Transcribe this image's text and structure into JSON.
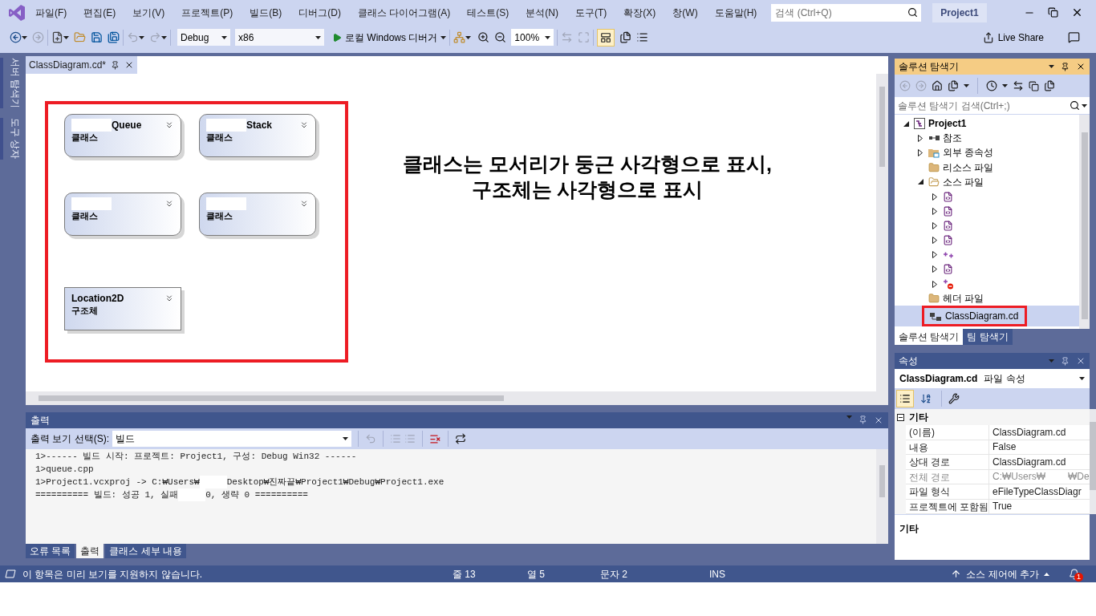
{
  "title_bar": {
    "menus": [
      "파일(F)",
      "편집(E)",
      "보기(V)",
      "프로젝트(P)",
      "빌드(B)",
      "디버그(D)",
      "클래스 다이어그램(A)",
      "테스트(S)",
      "분석(N)",
      "도구(T)",
      "확장(X)",
      "창(W)",
      "도움말(H)"
    ],
    "search": {
      "placeholder": "검색 (Ctrl+Q)"
    },
    "project_name": "Project1"
  },
  "toolbar": {
    "configuration": "Debug",
    "platform": "x86",
    "run_label": "로컬 Windows 디버거",
    "zoom": "100%",
    "display_toggle": {
      "on": true
    },
    "live_share": "Live Share"
  },
  "side_tabs": [
    "서버 탐색기",
    "도구 상자"
  ],
  "editor": {
    "tab": {
      "label": "ClassDiagram.cd*",
      "selected": true
    },
    "shapes": [
      {
        "kind": "class",
        "name": "Queue",
        "name_redacted": true,
        "type": "클래스"
      },
      {
        "kind": "class",
        "name": "Stack",
        "name_redacted": true,
        "type": "클래스"
      },
      {
        "kind": "class",
        "name_redacted": true,
        "type": "클래스"
      },
      {
        "kind": "class",
        "name_redacted": true,
        "type": "클래스"
      },
      {
        "kind": "struct",
        "name": "Location2D",
        "name_redacted": false,
        "type": "구조체"
      }
    ],
    "annotation": [
      "클래스는 모서리가 둥근 사각형으로 표시,",
      "구조체는 사각형으로 표시"
    ]
  },
  "output": {
    "title": "출력",
    "source_label": "출력 보기 선택(S):",
    "source": "빌드",
    "lines": [
      {
        "parts": [
          "1>------ 빌드 시작: 프로젝트: Project1, 구성: Debug Win32 ------"
        ]
      },
      {
        "parts": [
          "1>queue.cpp"
        ]
      },
      {
        "parts": [
          "1>Project1.vcxproj -> C:₩Users₩",
          "Desktop₩진짜끝₩Project1₩Debug₩Project1.exe"
        ]
      },
      {
        "parts": [
          "========== 빌드: 성공 1, 실패",
          "0, 생략 0 =========="
        ]
      }
    ],
    "tabs": [
      {
        "label": "오류 목록",
        "selected": false
      },
      {
        "label": "출력",
        "selected": true
      },
      {
        "label": "클래스 세부 내용",
        "selected": false
      }
    ]
  },
  "solution_explorer": {
    "title": "솔루션 탐색기",
    "search": {
      "placeholder": "솔루션 탐색기 검색(Ctrl+;)"
    },
    "tree": [
      {
        "label": "Project1",
        "kind": "project",
        "expanded": true,
        "selected": false,
        "children": [
          {
            "label": "참조",
            "kind": "references",
            "expanded": false,
            "selected": false
          },
          {
            "label": "외부 종속성",
            "kind": "external",
            "expanded": false,
            "selected": false
          },
          {
            "label": "리소스 파일",
            "kind": "filter",
            "selected": false
          },
          {
            "label": "소스 파일",
            "kind": "filter-open",
            "expanded": true,
            "selected": false,
            "children": [
              {
                "kind": "header",
                "expanded": false,
                "selected": false
              },
              {
                "kind": "header",
                "expanded": false,
                "selected": false
              },
              {
                "kind": "header",
                "expanded": false,
                "selected": false
              },
              {
                "kind": "header",
                "expanded": false,
                "selected": false
              },
              {
                "kind": "cpp",
                "expanded": false,
                "selected": false
              },
              {
                "kind": "header",
                "expanded": false,
                "selected": false
              },
              {
                "kind": "cpp-error",
                "expanded": false,
                "selected": false
              }
            ]
          },
          {
            "label": "헤더 파일",
            "kind": "filter",
            "selected": false
          },
          {
            "label": "ClassDiagram.cd",
            "kind": "diagram",
            "selected": true
          }
        ]
      }
    ],
    "tabs": [
      {
        "label": "솔루션 탐색기",
        "selected": true
      },
      {
        "label": "팀 탐색기",
        "selected": false
      }
    ]
  },
  "properties": {
    "title": "속성",
    "object": "ClassDiagram.cd",
    "object_type": "파일 속성",
    "categorized": true,
    "category": {
      "label": "기타",
      "expanded": true
    },
    "rows": [
      {
        "name": "(이름)",
        "value": [
          "ClassDiagram.cd"
        ],
        "disabled": false
      },
      {
        "name": "내용",
        "value": [
          "False"
        ],
        "disabled": false
      },
      {
        "name": "상대 경로",
        "value": [
          "ClassDiagram.cd"
        ],
        "disabled": false
      },
      {
        "name": "전체 경로",
        "value": [
          "C:₩Users₩",
          "₩De"
        ],
        "disabled": true
      },
      {
        "name": "파일 형식",
        "value": [
          "eFileTypeClassDiagr"
        ],
        "disabled": false
      },
      {
        "name": "프로젝트에 포함됨",
        "value": [
          "True"
        ],
        "disabled": false
      }
    ],
    "description": "기타"
  },
  "status_bar": {
    "message": "이 항목은 미리 보기를 지원하지 않습니다.",
    "line": "줄 13",
    "column": "열 5",
    "char": "문자 2",
    "mode": "INS",
    "source_control": "소스 제어에 추가",
    "notifications": "1"
  }
}
